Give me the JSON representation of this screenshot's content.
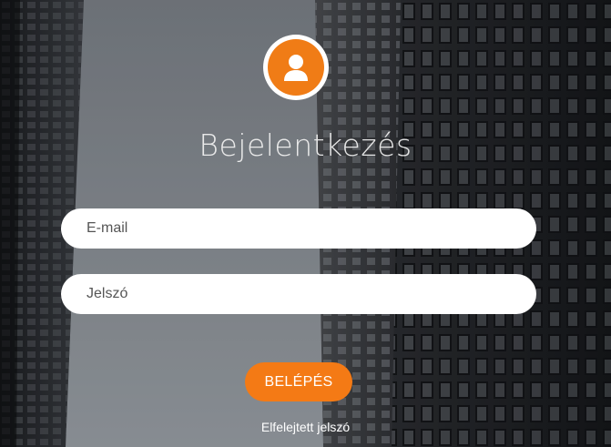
{
  "login": {
    "title": "Bejelentkezés",
    "email_placeholder": "E-mail",
    "password_placeholder": "Jelszó",
    "submit_label": "BELÉPÉS",
    "forgot_label": "Elfelejtett jelszó"
  },
  "icons": {
    "avatar": "user-icon"
  },
  "colors": {
    "accent": "#f47a15",
    "field_bg": "#ffffff",
    "title_text": "#f3f3f3"
  }
}
